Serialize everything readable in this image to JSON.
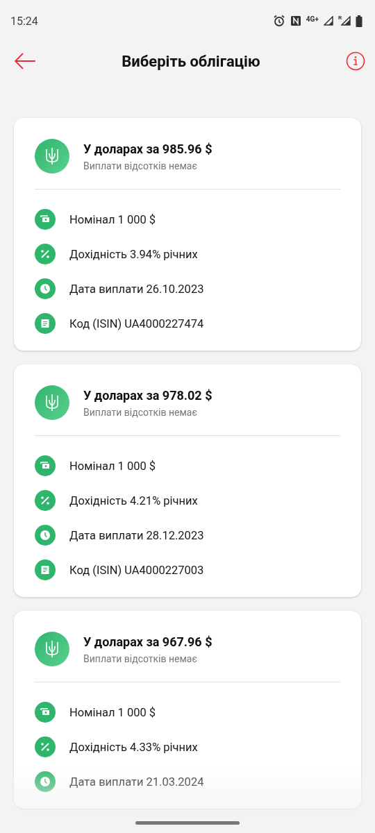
{
  "status_bar": {
    "time": "15:24",
    "network": "4G+",
    "roaming": "R"
  },
  "header": {
    "title": "Виберіть облігацію"
  },
  "bonds": [
    {
      "title": "У доларах за 985.96 $",
      "subtitle": "Виплати відсотків немає",
      "details": [
        {
          "kind": "nominal",
          "text": "Номінал 1 000 $"
        },
        {
          "kind": "yield",
          "text": "Дохідність 3.94% річних"
        },
        {
          "kind": "date",
          "text": "Дата виплати 26.10.2023"
        },
        {
          "kind": "code",
          "text": "Код (ISIN) UA4000227474"
        }
      ]
    },
    {
      "title": "У доларах за 978.02 $",
      "subtitle": "Виплати відсотків немає",
      "details": [
        {
          "kind": "nominal",
          "text": "Номінал 1 000 $"
        },
        {
          "kind": "yield",
          "text": "Дохідність 4.21% річних"
        },
        {
          "kind": "date",
          "text": "Дата виплати 28.12.2023"
        },
        {
          "kind": "code",
          "text": "Код (ISIN) UA4000227003"
        }
      ]
    },
    {
      "title": "У доларах за 967.96 $",
      "subtitle": "Виплати відсотків немає",
      "details": [
        {
          "kind": "nominal",
          "text": "Номінал 1 000 $"
        },
        {
          "kind": "yield",
          "text": "Дохідність 4.33% річних"
        },
        {
          "kind": "date",
          "text": "Дата виплати 21.03.2024"
        }
      ]
    }
  ]
}
